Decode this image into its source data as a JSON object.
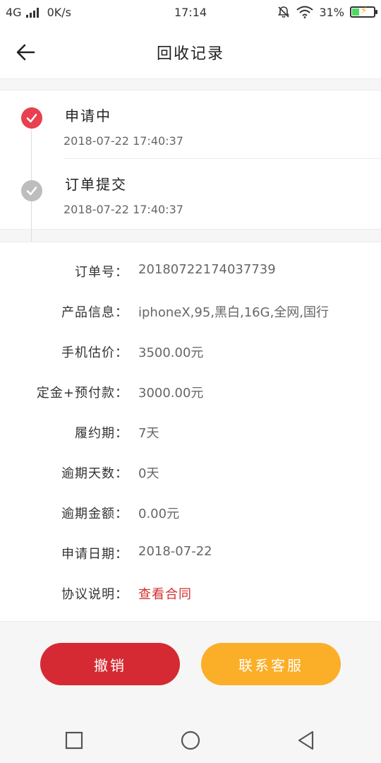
{
  "status_bar": {
    "network": "4G",
    "speed": "0K/s",
    "time": "17:14",
    "battery": "31%"
  },
  "header": {
    "title": "回收记录"
  },
  "timeline": [
    {
      "title": "申请中",
      "time": "2018-07-22 17:40:37",
      "state": "active"
    },
    {
      "title": "订单提交",
      "time": "2018-07-22 17:40:37",
      "state": "done"
    }
  ],
  "details": {
    "order_no": {
      "label": "订单号：",
      "value": "20180722174037739"
    },
    "product": {
      "label": "产品信息：",
      "value": "iphoneX,95,黑白,16G,全网,国行"
    },
    "estimate": {
      "label": "手机估价：",
      "value": "3500.00元"
    },
    "deposit": {
      "label": "定金+预付款：",
      "value": "3000.00元"
    },
    "term": {
      "label": "履约期：",
      "value": "7天"
    },
    "overdue_days": {
      "label": "逾期天数：",
      "value": "0天"
    },
    "overdue_amount": {
      "label": "逾期金额：",
      "value": "0.00元"
    },
    "apply_date": {
      "label": "申请日期：",
      "value": "2018-07-22"
    },
    "agreement": {
      "label": "协议说明：",
      "value": "查看合同"
    }
  },
  "actions": {
    "cancel_label": "撤销",
    "service_label": "联系客服"
  },
  "colors": {
    "accent_red": "#d52a33",
    "accent_orange": "#fbae27",
    "timeline_active": "#e8404f",
    "timeline_done": "#bdbdbd",
    "link_red": "#d32f2f"
  },
  "icons": {
    "back": "arrow-left-icon",
    "check": "check-icon",
    "nav_recent": "square-icon",
    "nav_home": "circle-icon",
    "nav_back": "triangle-left-icon"
  }
}
